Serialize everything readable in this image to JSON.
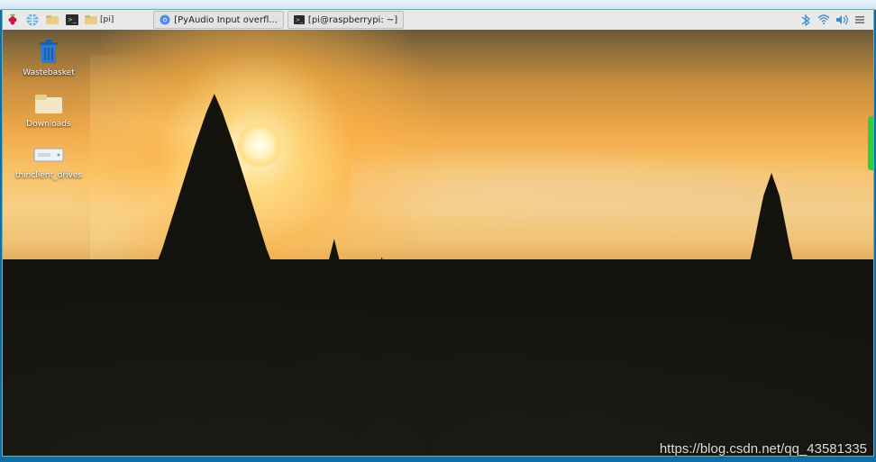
{
  "panel": {
    "menu_icon": "raspberry-icon",
    "launchers": [
      {
        "name": "web-browser-icon"
      },
      {
        "name": "file-manager-icon"
      },
      {
        "name": "terminal-icon"
      },
      {
        "name": "folder-pi-icon",
        "label": "[pi]"
      }
    ],
    "tasks": [
      {
        "icon": "chromium-icon",
        "label": "[PyAudio Input overfl..."
      },
      {
        "icon": "terminal-icon",
        "label": "[pi@raspberrypi: ~]"
      }
    ],
    "tray": [
      {
        "name": "bluetooth-icon"
      },
      {
        "name": "wifi-icon"
      },
      {
        "name": "volume-icon"
      },
      {
        "name": "menu-tray-icon"
      }
    ]
  },
  "desktop_icons": [
    {
      "name": "wastebasket",
      "label": "Wastebasket",
      "kind": "trash"
    },
    {
      "name": "downloads",
      "label": "Downloads",
      "kind": "folder"
    },
    {
      "name": "thinclient-drives",
      "label": "thinclient_drives",
      "kind": "drive"
    }
  ],
  "watermark": "https://blog.csdn.net/qq_43581335",
  "colors": {
    "panel_bg": "#e9e9e9",
    "tray_blue": "#3b8bd4",
    "raspberry": "#c51a4a"
  }
}
